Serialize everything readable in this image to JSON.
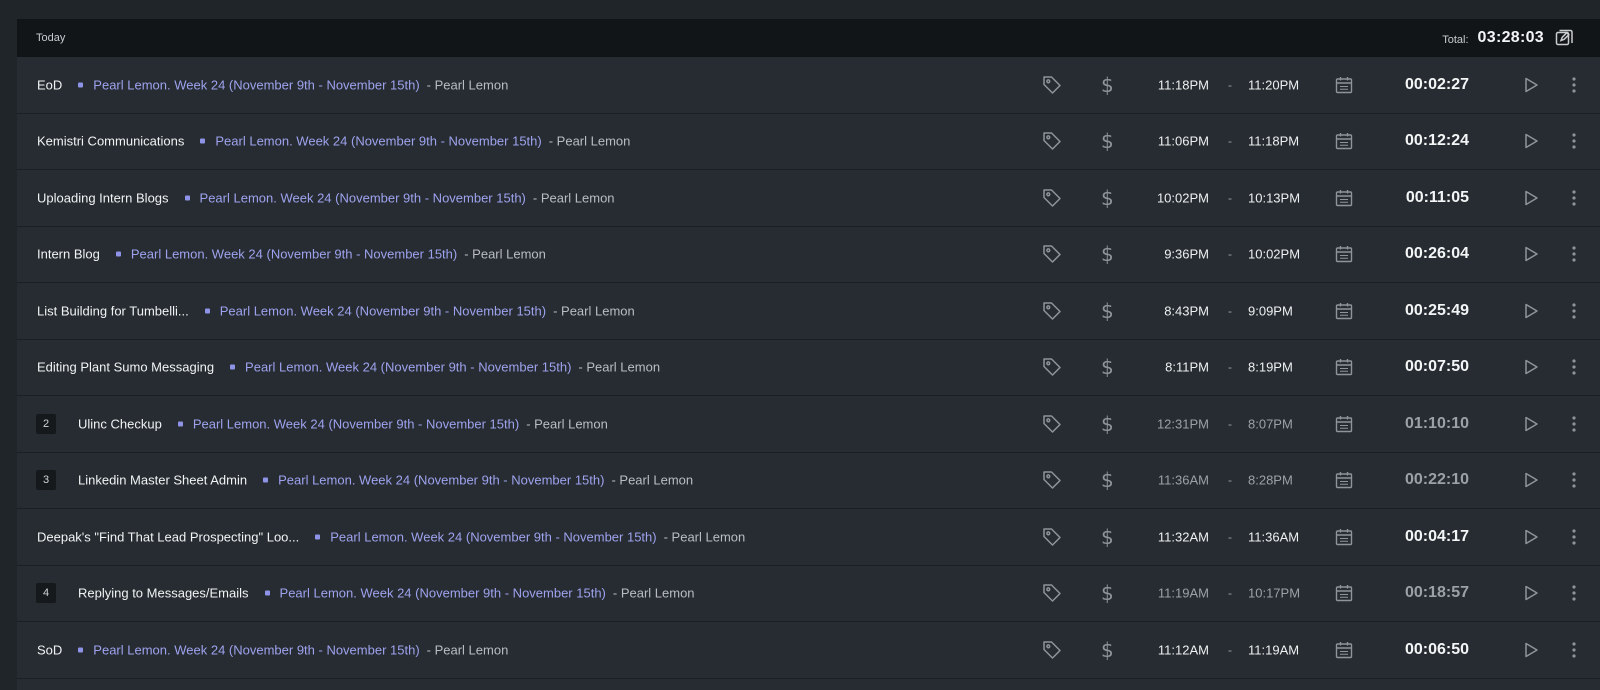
{
  "header": {
    "day_label": "Today",
    "total_label": "Total:",
    "total_value": "03:28:03"
  },
  "entries": [
    {
      "count": "",
      "description": "EoD",
      "project": "Pearl Lemon. Week 24 (November 9th - November 15th)",
      "client": "- Pearl Lemon",
      "start": "11:18PM",
      "end": "11:20PM",
      "duration": "00:02:27",
      "dim": false
    },
    {
      "count": "",
      "description": "Kemistri Communications",
      "project": "Pearl Lemon. Week 24 (November 9th - November 15th)",
      "client": "- Pearl Lemon",
      "start": "11:06PM",
      "end": "11:18PM",
      "duration": "00:12:24",
      "dim": false
    },
    {
      "count": "",
      "description": "Uploading Intern Blogs",
      "project": "Pearl Lemon. Week 24 (November 9th - November 15th)",
      "client": "- Pearl Lemon",
      "start": "10:02PM",
      "end": "10:13PM",
      "duration": "00:11:05",
      "dim": false
    },
    {
      "count": "",
      "description": "Intern Blog",
      "project": "Pearl Lemon. Week 24 (November 9th - November 15th)",
      "client": "- Pearl Lemon",
      "start": "9:36PM",
      "end": "10:02PM",
      "duration": "00:26:04",
      "dim": false
    },
    {
      "count": "",
      "description": "List Building for Tumbelli...",
      "project": "Pearl Lemon. Week 24 (November 9th - November 15th)",
      "client": "- Pearl Lemon",
      "start": "8:43PM",
      "end": "9:09PM",
      "duration": "00:25:49",
      "dim": false
    },
    {
      "count": "",
      "description": "Editing Plant Sumo Messaging",
      "project": "Pearl Lemon. Week 24 (November 9th - November 15th)",
      "client": "- Pearl Lemon",
      "start": "8:11PM",
      "end": "8:19PM",
      "duration": "00:07:50",
      "dim": false
    },
    {
      "count": "2",
      "description": "Ulinc Checkup",
      "project": "Pearl Lemon. Week 24 (November 9th - November 15th)",
      "client": "- Pearl Lemon",
      "start": "12:31PM",
      "end": "8:07PM",
      "duration": "01:10:10",
      "dim": true
    },
    {
      "count": "3",
      "description": "Linkedin Master Sheet Admin",
      "project": "Pearl Lemon. Week 24 (November 9th - November 15th)",
      "client": "- Pearl Lemon",
      "start": "11:36AM",
      "end": "8:28PM",
      "duration": "00:22:10",
      "dim": true
    },
    {
      "count": "",
      "description": "Deepak's \"Find That Lead Prospecting\" Loo...",
      "project": "Pearl Lemon. Week 24 (November 9th - November 15th)",
      "client": "- Pearl Lemon",
      "start": "11:32AM",
      "end": "11:36AM",
      "duration": "00:04:17",
      "dim": false
    },
    {
      "count": "4",
      "description": "Replying to Messages/Emails",
      "project": "Pearl Lemon. Week 24 (November 9th - November 15th)",
      "client": "- Pearl Lemon",
      "start": "11:19AM",
      "end": "10:17PM",
      "duration": "00:18:57",
      "dim": true
    },
    {
      "count": "",
      "description": "SoD",
      "project": "Pearl Lemon. Week 24 (November 9th - November 15th)",
      "client": "- Pearl Lemon",
      "start": "11:12AM",
      "end": "11:19AM",
      "duration": "00:06:50",
      "dim": false
    }
  ],
  "time_separator": "-",
  "currency_symbol": "$",
  "icons": {
    "tag": "tag-icon",
    "billable": "dollar-icon",
    "calendar": "calendar-icon",
    "play": "play-icon",
    "more": "more-vertical-icon",
    "bulk_edit": "bulk-edit-icon"
  },
  "colors": {
    "background": "#20252a",
    "panel": "#262c31",
    "header": "#121518",
    "project": "#9ea2ee",
    "icon": "#8e949a"
  }
}
